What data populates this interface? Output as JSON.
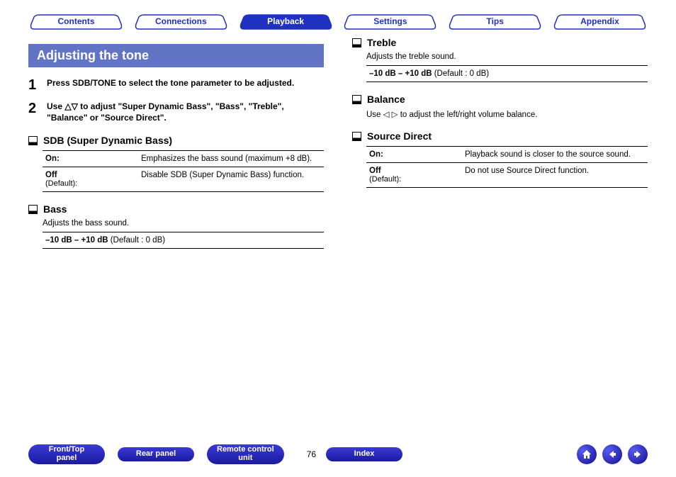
{
  "nav": {
    "tabs": [
      "Contents",
      "Connections",
      "Playback",
      "Settings",
      "Tips",
      "Appendix"
    ],
    "activeIndex": 2
  },
  "title": "Adjusting the tone",
  "steps": [
    {
      "num": "1",
      "text": "Press SDB/TONE to select the tone parameter to be adjusted."
    },
    {
      "num": "2",
      "text": "Use △▽ to adjust \"Super Dynamic Bass\", \"Bass\", \"Treble\", \"Balance\" or \"Source Direct\"."
    }
  ],
  "sdb": {
    "heading": "SDB (Super Dynamic Bass)",
    "rows": [
      {
        "label": "On:",
        "sub": "",
        "value": "Emphasizes the bass sound (maximum +8 dB)."
      },
      {
        "label": "Off",
        "sub": "(Default):",
        "value": "Disable SDB (Super Dynamic Bass) function."
      }
    ]
  },
  "bass": {
    "heading": "Bass",
    "desc": "Adjusts the bass sound.",
    "range_bold": "–10 dB – +10 dB",
    "range_rest": " (Default : 0 dB)"
  },
  "treble": {
    "heading": "Treble",
    "desc": "Adjusts the treble sound.",
    "range_bold": "–10 dB – +10 dB",
    "range_rest": " (Default : 0 dB)"
  },
  "balance": {
    "heading": "Balance",
    "desc": "Use ◁ ▷ to adjust the left/right volume balance."
  },
  "source_direct": {
    "heading": "Source Direct",
    "rows": [
      {
        "label": "On:",
        "sub": "",
        "value": "Playback sound is closer to the source sound."
      },
      {
        "label": "Off",
        "sub": "(Default):",
        "value": "Do not use Source Direct function."
      }
    ]
  },
  "footer": {
    "buttons": [
      "Front/Top panel",
      "Rear panel",
      "Remote control unit"
    ],
    "page": "76",
    "index": "Index"
  }
}
